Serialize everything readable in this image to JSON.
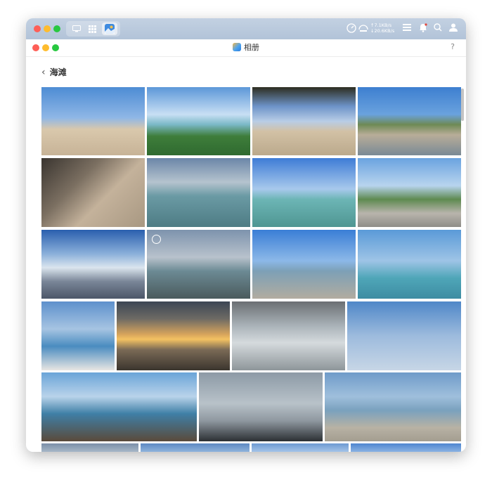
{
  "topbar": {
    "net_up": "↑7.1KB/s",
    "net_down": "↓20.6KB/s",
    "icons": [
      "desktop-icon",
      "grid-icon",
      "photos-app-icon",
      "speedometer-icon",
      "memory-gauge-icon",
      "task-list-icon",
      "bell-icon",
      "search-icon",
      "user-icon"
    ]
  },
  "window": {
    "title": "相册",
    "help": "?"
  },
  "album": {
    "back": "‹",
    "title": "海滩"
  },
  "colors": {
    "accent": "#2d7bd8",
    "close": "#fe5f57",
    "minimize": "#febc2e",
    "zoom": "#28c840"
  },
  "photos": [
    {
      "name": "photo-beach-fence-tree",
      "bg": "linear-gradient(#4d8cd4 0%,#8fb7e6 45%,#d9c8ac 62%,#c7b397 100%)"
    },
    {
      "name": "photo-sea-grass",
      "bg": "linear-gradient(#5c97d8 0%,#c8dff4 40%,#7ab8c6 55%,#3e7d3a 72%,#2f6a30 100%)"
    },
    {
      "name": "photo-beach-posts-tree",
      "bg": "linear-gradient(#2d2d20 0%,#6d93c8 28%,#b8cde6 50%,#d2c1a5 65%,#bba98c 100%)"
    },
    {
      "name": "photo-coast-rocks",
      "bg": "linear-gradient(#3d7fd0 0%,#6aa2de 40%,#6e8a55 55%,#b8ad98 70%,#7a8a96 100%)"
    },
    {
      "name": "photo-hand-sand",
      "bg": "linear-gradient(135deg,#3a3530 0%,#7b6f61 35%,#c4b29b 60%,#a89882 100%)"
    },
    {
      "name": "photo-woman-dress-sea",
      "bg": "linear-gradient(#6b86a8 0%,#b5c3ce 35%,#6a9aa4 55%,#4e7c84 100%)"
    },
    {
      "name": "photo-woman-shallow",
      "bg": "linear-gradient(#3e7cd6 0%,#a8c9ec 45%,#6cb5b5 60%,#4f9692 100%)"
    },
    {
      "name": "photo-promenade-palms",
      "bg": "linear-gradient(#6aa3e0 0%,#b8d4ee 40%,#5e8a50 60%,#b8b4ac 80%,#8f8d88 100%)"
    },
    {
      "name": "photo-sunrise-reflection",
      "bg": "linear-gradient(#2a5fae 0%,#8bb0da 35%,#dbe5ee 55%,#7a8698 75%,#4b5668 100%)"
    },
    {
      "name": "photo-woman-rocks",
      "bg": "linear-gradient(#7d93ad 0%,#b8c2cc 40%,#6c8a94 60%,#4a5a5c 100%)"
    },
    {
      "name": "photo-crowd-causeway",
      "bg": "linear-gradient(#3a7ed6 0%,#8cb8e8 45%,#7da0b6 60%,#b2aca0 100%)"
    },
    {
      "name": "photo-woman-camera",
      "bg": "linear-gradient(#5a9ad8 0%,#9ec4e6 45%,#4fa6b8 70%,#3d8ca2 100%)"
    },
    {
      "name": "photo-woman-selfie",
      "bg": "linear-gradient(#5d90cc 0%,#a6c4e2 40%,#4a8cc0 65%,#e8e6e2 100%)"
    },
    {
      "name": "photo-sunset",
      "bg": "linear-gradient(#3c4654 0%,#6d6a64 25%,#d8a55c 48%,#f3c262 55%,#7a6a56 70%,#3b352e 100%)"
    },
    {
      "name": "photo-woman-black-dress",
      "bg": "linear-gradient(#6b6f73 0%,#a9b2b8 35%,#d5dadd 60%,#8e969a 100%)"
    },
    {
      "name": "photo-woman-sunglasses-sky",
      "bg": "linear-gradient(#4f87c8 0%,#9dbbdd 50%,#c7d6e6 100%)"
    },
    {
      "name": "photo-postcard",
      "bg": "linear-gradient(#6aa4d8 0%,#b9d3ea 35%,#3f7fa6 60%,#5a4a3a 100%)"
    },
    {
      "name": "photo-pier-railing",
      "bg": "linear-gradient(#8d9aa6 0%,#b8c2c9 45%,#8f98a0 70%,#2b2f33 100%)"
    },
    {
      "name": "photo-calm-sea",
      "bg": "linear-gradient(#6f9bc9 0%,#9fbfdc 35%,#7aa1be 55%,#b8b2a4 80%,#a39d90 100%)"
    },
    {
      "name": "photo-bottom-1",
      "bg": "linear-gradient(#7b8fa8,#a7b7c7)"
    },
    {
      "name": "photo-bottom-2",
      "bg": "linear-gradient(#5d89c2,#8fb3dc)"
    },
    {
      "name": "photo-bottom-3",
      "bg": "linear-gradient(#6d9ad2,#a4c4e8)"
    },
    {
      "name": "photo-bottom-4",
      "bg": "linear-gradient(#4f86d0,#8ab2e2)"
    }
  ]
}
